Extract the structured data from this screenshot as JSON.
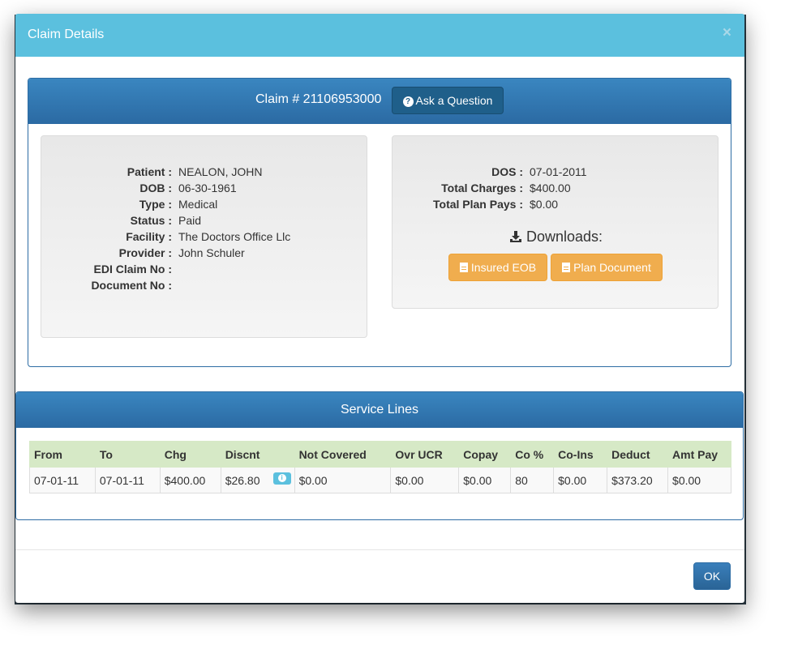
{
  "modal": {
    "title": "Claim Details",
    "close_label": "×"
  },
  "claim": {
    "title": "Claim # 21106953000",
    "ask_button_label": "Ask a Question",
    "left_fields": [
      {
        "label": "Patient :",
        "value": "NEALON, JOHN"
      },
      {
        "label": "DOB :",
        "value": "06-30-1961"
      },
      {
        "label": "Type :",
        "value": "Medical"
      },
      {
        "label": "Status :",
        "value": "Paid"
      },
      {
        "label": "Facility :",
        "value": "The Doctors Office Llc"
      },
      {
        "label": "Provider :",
        "value": "John Schuler"
      },
      {
        "label": "EDI Claim No :",
        "value": ""
      },
      {
        "label": "Document No :",
        "value": ""
      }
    ],
    "right_fields": [
      {
        "label": "DOS :",
        "value": "07-01-2011"
      },
      {
        "label": "Total Charges :",
        "value": "$400.00"
      },
      {
        "label": "Total Plan Pays :",
        "value": "$0.00"
      }
    ],
    "downloads_label": "Downloads:",
    "insured_eob_label": "Insured EOB",
    "plan_document_label": "Plan Document"
  },
  "service_lines": {
    "title": "Service Lines",
    "columns": [
      "From",
      "To",
      "Chg",
      "Discnt",
      "Not Covered",
      "Ovr UCR",
      "Copay",
      "Co %",
      "Co-Ins",
      "Deduct",
      "Amt Pay"
    ],
    "rows": [
      [
        "07-01-11",
        "07-01-11",
        "$400.00",
        "$26.80",
        "$0.00",
        "$0.00",
        "$0.00",
        "80",
        "$0.00",
        "$373.20",
        "$0.00"
      ]
    ]
  },
  "footer": {
    "ok_label": "OK"
  },
  "colors": {
    "header_bg": "#5bc0de",
    "panel_heading": "#2b6aa3",
    "orange": "#f0ad4e",
    "table_header": "#d6e9c6"
  },
  "icons": [
    "question-circle-icon",
    "download-icon",
    "file-icon",
    "info-icon",
    "close-icon"
  ]
}
